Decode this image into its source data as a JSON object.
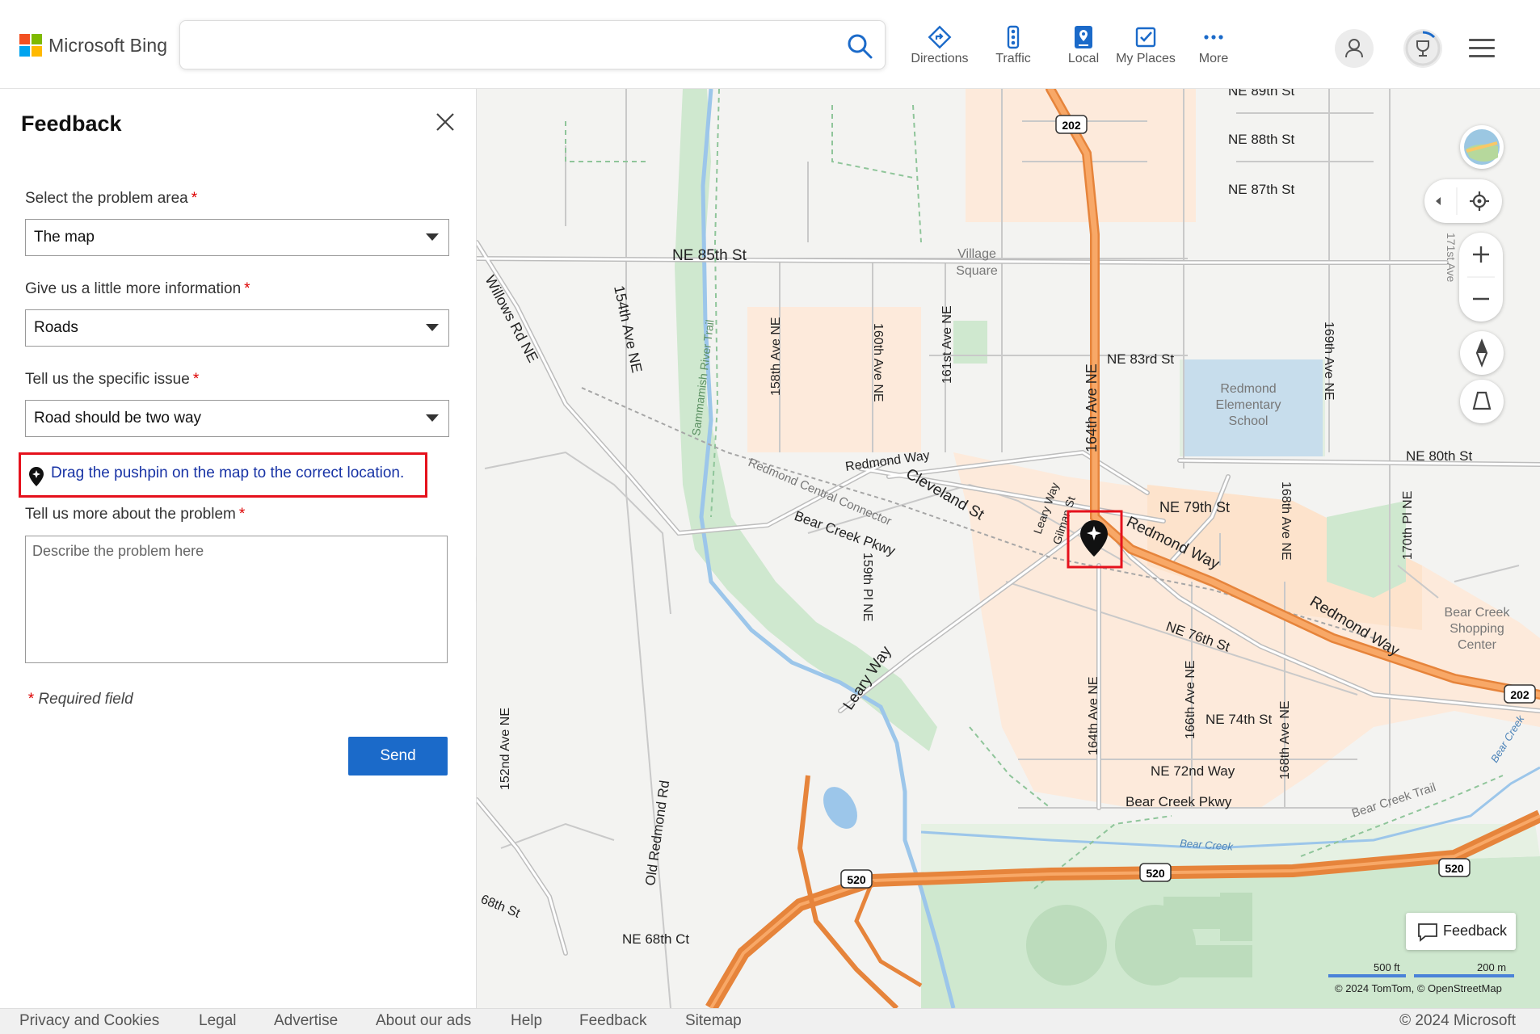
{
  "header": {
    "brand": "Microsoft Bing",
    "search_placeholder": "",
    "nav": [
      {
        "label": "Directions",
        "icon": "directions-icon"
      },
      {
        "label": "Traffic",
        "icon": "traffic-icon"
      },
      {
        "label": "Local",
        "icon": "local-icon"
      },
      {
        "label": "My Places",
        "icon": "my-places-icon"
      },
      {
        "label": "More",
        "icon": "more-icon"
      }
    ]
  },
  "panel": {
    "title": "Feedback",
    "problem_area_label": "Select the problem area",
    "problem_area_value": "The map",
    "more_info_label": "Give us a little more information",
    "more_info_value": "Roads",
    "specific_issue_label": "Tell us the specific issue",
    "specific_issue_value": "Road should be two way",
    "pin_hint": "Drag the pushpin on the map to the correct location.",
    "more_about_label": "Tell us more about the problem",
    "more_about_placeholder": "Describe the problem here",
    "required_star": "*",
    "required_note": "Required field",
    "send_label": "Send"
  },
  "map": {
    "labels": {
      "ne89": "NE 89th St",
      "ne88": "NE 88th St",
      "ne87": "NE 87th St",
      "ne85": "NE 85th St",
      "village": "Village",
      "square": "Square",
      "ne83": "NE 83rd St",
      "redmond_el1": "Redmond",
      "redmond_el2": "Elementary",
      "redmond_el3": "School",
      "ne80": "NE 80th St",
      "ne79": "NE 79th St",
      "willows": "Willows Rd NE",
      "ave154": "154th Ave NE",
      "sammamish": "Sammamish River Trail",
      "ave158": "158th Ave NE",
      "ave160": "160th Ave NE",
      "ave161": "161st Ave NE",
      "ave164n": "164th Ave NE",
      "ave169": "169th Ave NE",
      "ave171": "171st Ave",
      "redmond_way1": "Redmond Way",
      "connector": "Redmond Central Connector",
      "cleveland": "Cleveland St",
      "leary1": "Leary Way",
      "gilman": "Gilman St",
      "redmond_way2": "Redmond Way",
      "bear_pkwy1": "Bear Creek Pkwy",
      "pl159": "159th Pl NE",
      "ave168n": "168th Ave NE",
      "pl170": "170th Pl NE",
      "redmond_way3": "Redmond Way",
      "bc_shop1": "Bear Creek",
      "bc_shop2": "Shopping",
      "bc_shop3": "Center",
      "ne76": "NE 76th St",
      "leary2": "Leary Way",
      "ave164s": "164th Ave NE",
      "ave166": "166th Ave NE",
      "ne74": "NE 74th St",
      "ave168s": "168th Ave NE",
      "ave152": "152nd Ave NE",
      "old_redmond": "Old Redmond Rd",
      "ne72": "NE 72nd Way",
      "bear_pkwy2": "Bear Creek Pkwy",
      "bc_trail": "Bear Creek Trail",
      "bc_water": "Bear Creek",
      "bc_water2": "Bear Creek",
      "st68": "68th St",
      "ne68ct": "NE 68th Ct",
      "hw202a": "202",
      "hw202b": "202",
      "hw520a": "520",
      "hw520b": "520",
      "hw520c": "520"
    },
    "feedback_label": "Feedback",
    "scale_ft": "500 ft",
    "scale_m": "200 m",
    "attribution": "© 2024 TomTom, © OpenStreetMap"
  },
  "footer": {
    "links": [
      "Privacy and Cookies",
      "Legal",
      "Advertise",
      "About our ads",
      "Help",
      "Feedback",
      "Sitemap"
    ],
    "copyright": "© 2024 Microsoft"
  },
  "colors": {
    "accent": "#1b6ac9",
    "highlight": "#e5111c",
    "link": "#1833a5",
    "urban": "#fde9d6",
    "park": "#cfe8cf",
    "highway": "#f59a52"
  }
}
